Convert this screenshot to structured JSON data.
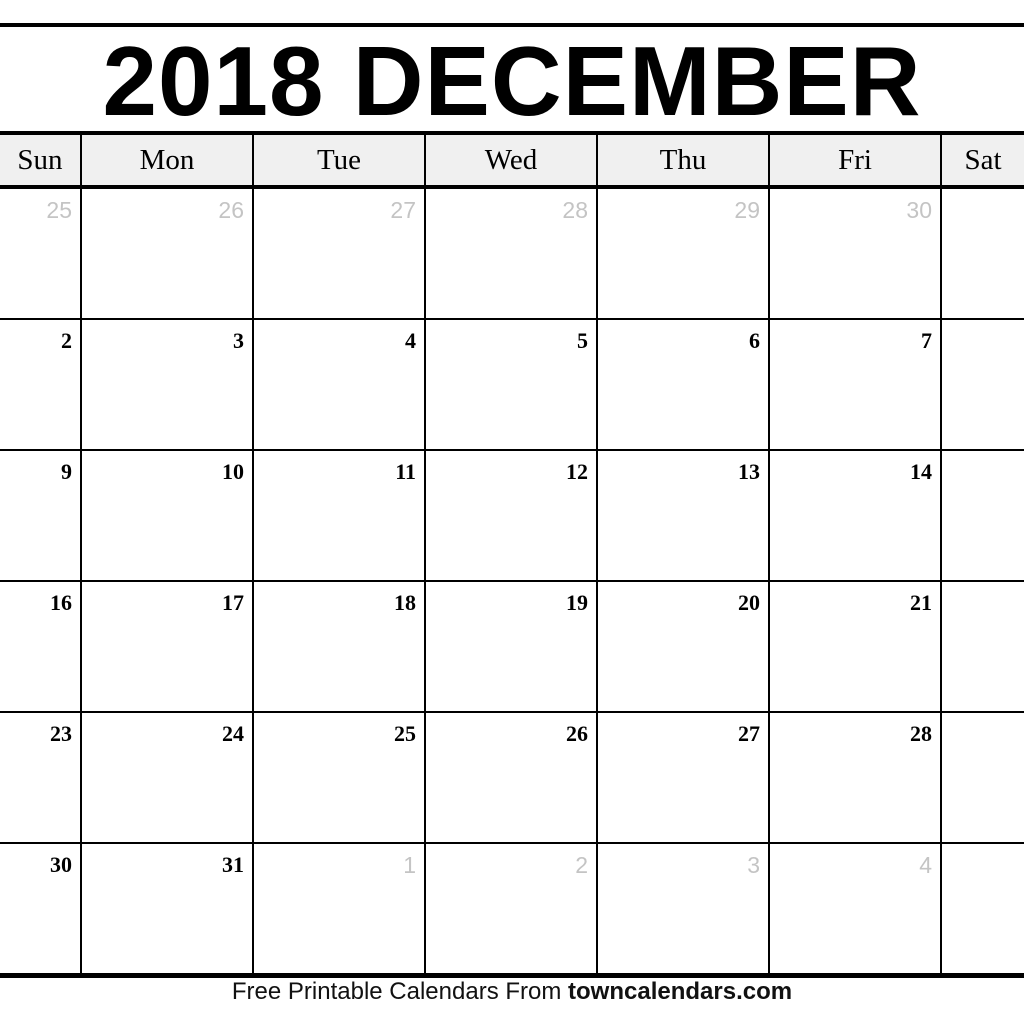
{
  "title": "2018 DECEMBER",
  "weekdays": [
    "Sun",
    "Mon",
    "Tue",
    "Wed",
    "Thu",
    "Fri",
    "Sat"
  ],
  "weeks": [
    [
      {
        "d": "25",
        "other": true
      },
      {
        "d": "26",
        "other": true
      },
      {
        "d": "27",
        "other": true
      },
      {
        "d": "28",
        "other": true
      },
      {
        "d": "29",
        "other": true
      },
      {
        "d": "30",
        "other": true
      },
      {
        "d": "",
        "other": false
      }
    ],
    [
      {
        "d": "2"
      },
      {
        "d": "3"
      },
      {
        "d": "4"
      },
      {
        "d": "5"
      },
      {
        "d": "6"
      },
      {
        "d": "7"
      },
      {
        "d": ""
      }
    ],
    [
      {
        "d": "9"
      },
      {
        "d": "10"
      },
      {
        "d": "11"
      },
      {
        "d": "12"
      },
      {
        "d": "13"
      },
      {
        "d": "14"
      },
      {
        "d": ""
      }
    ],
    [
      {
        "d": "16"
      },
      {
        "d": "17"
      },
      {
        "d": "18"
      },
      {
        "d": "19"
      },
      {
        "d": "20"
      },
      {
        "d": "21"
      },
      {
        "d": ""
      }
    ],
    [
      {
        "d": "23"
      },
      {
        "d": "24"
      },
      {
        "d": "25"
      },
      {
        "d": "26"
      },
      {
        "d": "27"
      },
      {
        "d": "28"
      },
      {
        "d": ""
      }
    ],
    [
      {
        "d": "30"
      },
      {
        "d": "31"
      },
      {
        "d": "1",
        "other": true
      },
      {
        "d": "2",
        "other": true
      },
      {
        "d": "3",
        "other": true
      },
      {
        "d": "4",
        "other": true
      },
      {
        "d": ""
      }
    ]
  ],
  "footer": {
    "text": "Free Printable Calendars From ",
    "site": "towncalendars.com"
  },
  "colors": {
    "other_month": "#c4c4c4",
    "header_bg": "#f0f0f0"
  }
}
